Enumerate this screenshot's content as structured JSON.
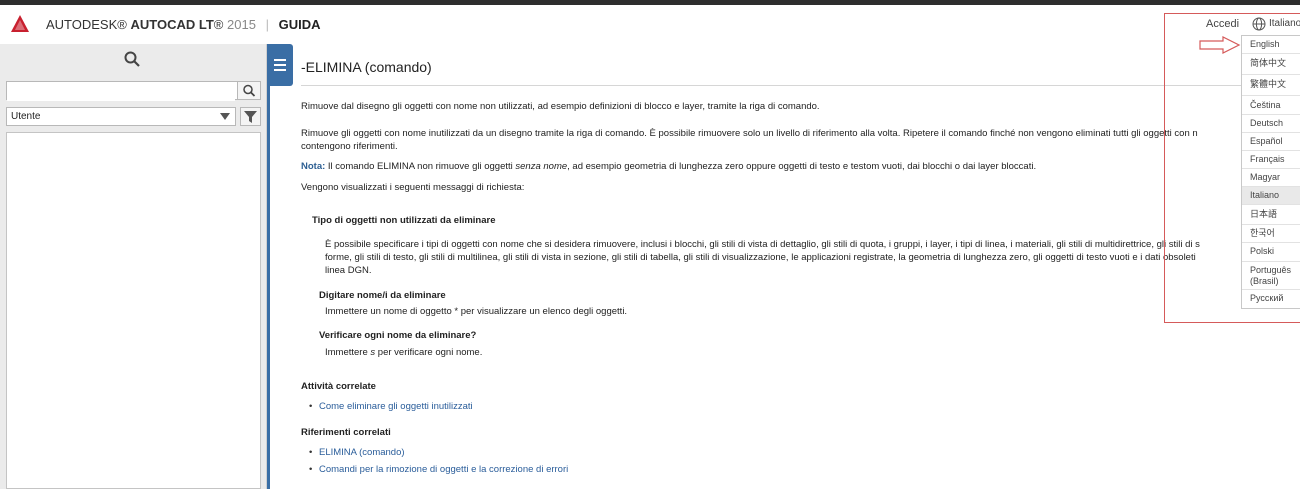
{
  "header": {
    "brand_autodesk": "AUTODESK",
    "brand_product": "AUTOCAD LT",
    "brand_version": "2015",
    "brand_section": "GUIDA",
    "signin": "Accedi",
    "language_current": "Italiano"
  },
  "sidebar": {
    "search_placeholder": "",
    "filter_value": "Utente"
  },
  "content": {
    "title": "-ELIMINA (comando)",
    "para1": "Rimuove dal disegno gli oggetti con nome non utilizzati, ad esempio definizioni di blocco e layer, tramite la riga di comando.",
    "para2_line1": "Rimuove gli oggetti con nome inutilizzati da un disegno tramite la riga di comando. È possibile rimuovere solo un livello di riferimento alla volta. Ripetere il comando finché non vengono eliminati tutti gli oggetti con n",
    "para2_line2": "contengono riferimenti.",
    "nota_label": "Nota:",
    "nota_text_a": "Il comando ELIMINA non rimuove gli oggetti",
    "nota_text_em": "senza nome",
    "nota_text_b": ", ad esempio geometria di lunghezza zero oppure oggetti di testo e testom vuoti, dai blocchi o dai layer bloccati.",
    "prompts_intro": "Vengono visualizzati i seguenti messaggi di richiesta:",
    "section1_heading": "Tipo di oggetti non utilizzati da eliminare",
    "section1_line1": "È possibile specificare i tipi di oggetti con nome che si desidera rimuovere, inclusi i blocchi, gli stili di vista di dettaglio, gli stili di quota, i gruppi, i layer, i tipi di linea, i materiali, gli stili di multidirettrice, gli stili di s",
    "section1_line2": "forme, gli stili di testo, gli stili di multilinea, gli stili di vista in sezione, gli stili di tabella, gli stili di visualizzazione, le applicazioni registrate, la geometria di lunghezza zero, gli oggetti di testo vuoti e i dati obsoleti",
    "section1_line3": "linea DGN.",
    "section2_heading": "Digitare nome/i da eliminare",
    "section2_text": "Immettere un nome di oggetto  * per visualizzare un elenco degli oggetti.",
    "section3_heading": "Verificare ogni nome da eliminare?",
    "section3_text_a": "Immettere",
    "section3_text_em": "s",
    "section3_text_b": "per verificare ogni nome.",
    "related_tasks_heading": "Attività correlate",
    "related_tasks": [
      "Come eliminare gli oggetti inutilizzati"
    ],
    "related_refs_heading": "Riferimenti correlati",
    "related_refs": [
      "ELIMINA (comando)",
      "Comandi per la rimozione di oggetti e la correzione di errori"
    ]
  },
  "languages": {
    "items": [
      "English",
      "简体中文",
      "繁體中文",
      "Čeština",
      "Deutsch",
      "Español",
      "Français",
      "Magyar",
      "Italiano",
      "日本語",
      "한국어",
      "Polski",
      "Português",
      "(Brasil)",
      "Русский"
    ],
    "selected": "Italiano"
  },
  "colors": {
    "accent_blue": "#3a6ea5",
    "link_blue": "#2a5d9a",
    "highlight_red": "#d55a5a",
    "logo_red": "#c8202f"
  }
}
